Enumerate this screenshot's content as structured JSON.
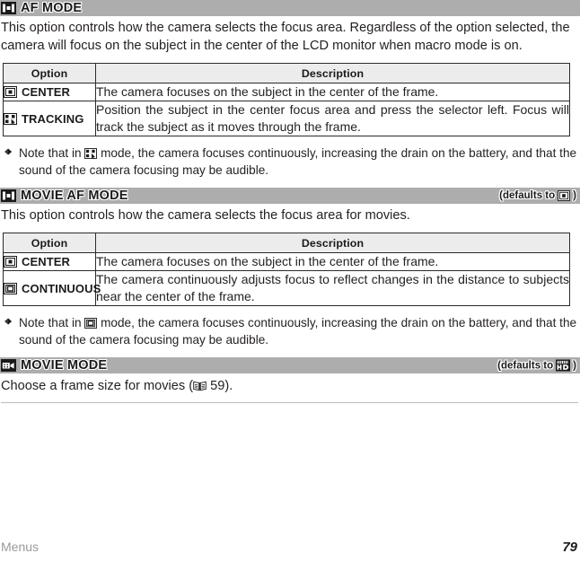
{
  "page": {
    "footer_label": "Menus",
    "page_number": "79"
  },
  "sections": [
    {
      "id": "af-mode",
      "icon": "af-area-icon",
      "title": "AF MODE",
      "default_prefix": "",
      "default_icon": "",
      "intro": "This option controls how the camera selects the focus area.  Regardless of the option selected, the camera will focus on the subject in the center of the LCD monitor when macro mode is on.",
      "table": {
        "headers": [
          "Option",
          "Description"
        ],
        "rows": [
          {
            "icon": "center-focus-icon",
            "label": "CENTER",
            "description": "The camera focuses on the subject in the center of the frame."
          },
          {
            "icon": "tracking-focus-icon",
            "label": "TRACKING",
            "description": "Position the subject in the center focus area and press the selector left.  Focus will track the subject as it moves through the frame."
          }
        ]
      },
      "note": {
        "bullet": "diamond-bullet-icon",
        "before": "Note that in ",
        "icon": "tracking-focus-icon",
        "after": " mode, the camera focuses continuously, increasing the drain on the battery, and that the sound of the camera focusing may be audible."
      }
    },
    {
      "id": "movie-af-mode",
      "icon": "af-area-icon",
      "title": "MOVIE AF MODE",
      "default_prefix": "(defaults to ",
      "default_suffix": ")",
      "default_icon": "center-focus-icon",
      "intro": "This option controls how the camera selects the focus area for movies.",
      "table": {
        "headers": [
          "Option",
          "Description"
        ],
        "rows": [
          {
            "icon": "center-focus-icon",
            "label": "CENTER",
            "description": "The camera focuses on the subject in the center of the frame."
          },
          {
            "icon": "continuous-focus-icon",
            "label": "CONTINUOUS",
            "description": "The camera continuously adjusts focus to reflect changes in the distance to subjects near the center of the frame."
          }
        ]
      },
      "note": {
        "bullet": "diamond-bullet-icon",
        "before": "Note that in ",
        "icon": "continuous-focus-icon",
        "after": " mode, the camera focuses continuously, increasing the drain on the battery, and that the sound of the camera focusing may be audible."
      }
    },
    {
      "id": "movie-mode",
      "icon": "movie-camera-icon",
      "title": "MOVIE MODE",
      "default_prefix": "(defaults to ",
      "default_suffix": ")",
      "default_icon": "full-hd-icon",
      "body_before": "Choose a frame size for movies (",
      "body_ref_icon": "book-reference-icon",
      "body_ref_page": " 59",
      "body_after": ")."
    }
  ]
}
